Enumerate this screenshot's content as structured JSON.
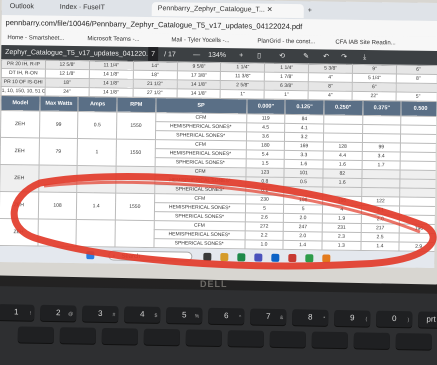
{
  "browser": {
    "tabs": [
      "Outlook",
      "Index · FuseIT",
      "Pennbarry_Zephyr_Catalogue_T..."
    ],
    "url": "pennbarry.com/file/10046/Pennbarry_Zephyr_Catalogue_T5_v17_updates_04122024.pdf",
    "bookmarks": [
      "Home - Smartsheet...",
      "Microsoft Teams -...",
      "Mail - Tyler Yocells -...",
      "PlanGrid - the const...",
      "CFA IAB Site Readin..."
    ]
  },
  "pdf": {
    "filename": "Zephyr_Catalogue_T5_v17_updates_041220...",
    "page": "7",
    "total": "/ 17",
    "zoom": "134%"
  },
  "top_rows": [
    [
      "PR 20 IH, R-IP",
      "12 5/8\"",
      "11 1/4\"",
      "14\"",
      "9 5/8\"",
      "1 1/4\"",
      "1 1/4\"",
      "5 3/8\"",
      "9\"",
      "6\""
    ],
    [
      "DT IH, R-ON",
      "12 1/8\"",
      "14 1/8\"",
      "18\"",
      "17 3/8\"",
      "11 3/8\"",
      "1 7/8\"",
      "4\"",
      "5 1/4\"",
      "8\""
    ],
    [
      "PR 10 OF IS-GHI",
      "18\"",
      "14 1/8\"",
      "21 1/2\"",
      "14 1/8\"",
      "2 5/8\"",
      "6 3/8\"",
      "8\"",
      "6\"",
      ""
    ],
    [
      "1, 10, 150, 10, 51 GHI and 51-GHI",
      "24\"",
      "14 1/8\"",
      "27 1/2\"",
      "14 1/8\"",
      "1\"",
      "1\"",
      "4\"",
      "22\"",
      "5\""
    ]
  ],
  "table_header": [
    "Model",
    "Max Watts",
    "Amps",
    "RPM",
    "SP",
    "0.000\"",
    "0.125\"",
    "0.250\"",
    "0.375\"",
    "0.500"
  ],
  "model_rows": [
    {
      "model": "ZEH",
      "watts": "99",
      "amps": "0.5",
      "rpm": "1550",
      "lines": [
        [
          "CFM",
          "119",
          "84",
          "",
          "",
          ""
        ],
        [
          "HEMISPHERICAL SONES*",
          "4.5",
          "4.1",
          "",
          "",
          ""
        ],
        [
          "SPHERICAL SONES*",
          "3.6",
          "3.2",
          "",
          "",
          ""
        ]
      ]
    },
    {
      "model": "ZEH",
      "watts": "79",
      "amps": "1",
      "rpm": "1550",
      "lines": [
        [
          "CFM",
          "180",
          "169",
          "128",
          "99",
          ""
        ],
        [
          "HEMISPHERICAL SONES*",
          "5.4",
          "3.3",
          "4.4",
          "3.4",
          ""
        ],
        [
          "SPHERICAL SONES*",
          "1.5",
          "1.6",
          "1.6",
          "1.7",
          ""
        ]
      ]
    },
    {
      "model": "ZEH",
      "watts": "",
      "amps": "",
      "rpm": "",
      "lines": [
        [
          "CFM",
          "123",
          "101",
          "82",
          "",
          ""
        ],
        [
          "HEMISPHERICAL SONES*",
          "0.8",
          "0.5",
          "1.6",
          "",
          ""
        ],
        [
          "SPHERICAL SONES*",
          "0.1",
          "",
          "",
          "",
          ""
        ]
      ]
    },
    {
      "model": "ZEH",
      "watts": "108",
      "amps": "1.4",
      "rpm": "1550",
      "lines": [
        [
          "CFM",
          "230",
          "196",
          "166",
          "122",
          ""
        ],
        [
          "HEMISPHERICAL SONES*",
          "5",
          "5",
          "4",
          "3.1",
          ""
        ],
        [
          "SPHERICAL SONES*",
          "2.6",
          "2.0",
          "1.9",
          "2.0",
          ""
        ]
      ]
    },
    {
      "model": "ZEH",
      "watts": "",
      "amps": "",
      "rpm": "",
      "lines": [
        [
          "CFM",
          "272",
          "247",
          "231",
          "217",
          "196"
        ],
        [
          "HEMISPHERICAL SONES*",
          "2.2",
          "2.0",
          "2.3",
          "2.5",
          ""
        ],
        [
          "SPHERICAL SONES*",
          "1.0",
          "1.4",
          "1.3",
          "1.4",
          "2.9"
        ]
      ]
    }
  ],
  "taskbar": {
    "search_placeholder": "Search"
  },
  "brand": "DELL",
  "keys": {
    "row1": [
      "!",
      "@",
      "#",
      "$",
      "%",
      "^",
      "&",
      "*",
      "(",
      ")",
      "home"
    ],
    "row2": [
      "1",
      "2",
      "3",
      "4",
      "5",
      "6",
      "7",
      "8",
      "9",
      "0",
      "prt sc"
    ]
  },
  "colors": {
    "annotation": "#e23b2a",
    "pdf_toolbar": "#3c4043",
    "table_header": "#5a6f86"
  }
}
